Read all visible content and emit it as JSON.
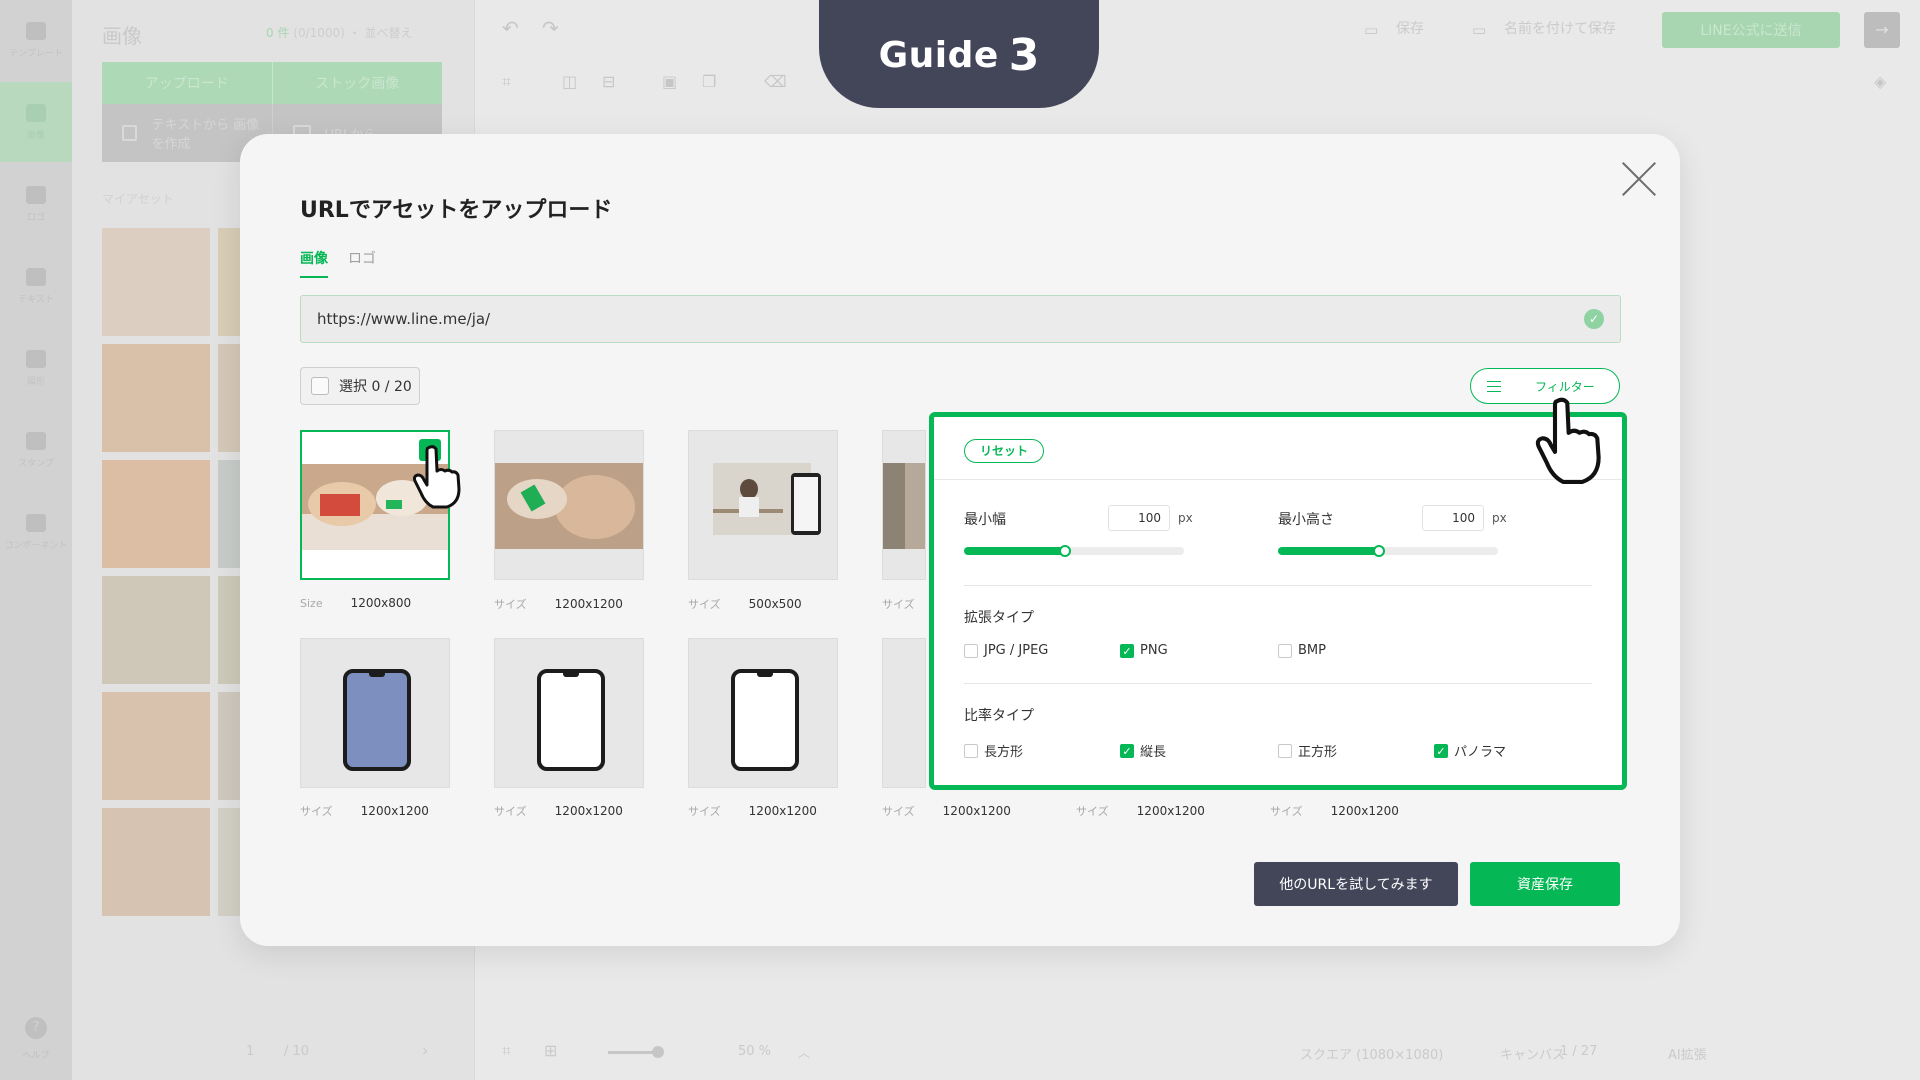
{
  "guide": {
    "label": "Guide",
    "number": "3"
  },
  "background": {
    "rail": [
      {
        "label": "テンプレート",
        "icon": "template-icon"
      },
      {
        "label": "画像",
        "icon": "image-icon"
      },
      {
        "label": "ロゴ",
        "icon": "logo-icon"
      },
      {
        "label": "テキスト",
        "icon": "text-icon"
      },
      {
        "label": "図形",
        "icon": "shape-icon"
      },
      {
        "label": "スタンプ",
        "icon": "stamp-icon"
      },
      {
        "label": "コンポーネント",
        "icon": "component-icon"
      }
    ],
    "rail_help": "ヘルプ",
    "panel_title": "画像",
    "panel_count_num": "0 件",
    "panel_count_rest": "(0/1000) ・ 並べ替え",
    "upload_tabs": [
      "アップロード",
      "ストック画像"
    ],
    "upload_buttons": [
      "テキストから 画像を作成",
      "URLから"
    ],
    "my_assets": "マイアセット",
    "save": "保存",
    "save_as": "名前を付けて保存",
    "send": "LINE公式に送信",
    "bottom": {
      "page_current": "1",
      "page_total": "/ 10",
      "zoom": "50 %",
      "canvas_size": "スクエア (1080×1080)",
      "canvas_label": "キャンバス",
      "canvas_pages": "1 / 27",
      "ai": "AI拡張"
    }
  },
  "modal": {
    "title": "URLでアセットをアップロード",
    "tabs": [
      "画像",
      "ロゴ"
    ],
    "url_value": "https://www.line.me/ja/",
    "select_label": "選択 0 / 20",
    "filter_label": "フィルター",
    "items": [
      {
        "size_key": "Size",
        "size": "1200x800",
        "selected": true
      },
      {
        "size_key": "サイズ",
        "size": "1200x1200",
        "selected": false
      },
      {
        "size_key": "サイズ",
        "size": "500x500",
        "selected": false
      },
      {
        "size_key": "サイズ",
        "size": "",
        "selected": false
      },
      {
        "size_key": "サイズ",
        "size": "1200x1200",
        "selected": false
      },
      {
        "size_key": "サイズ",
        "size": "1200x1200",
        "selected": false
      },
      {
        "size_key": "サイズ",
        "size": "1200x1200",
        "selected": false
      },
      {
        "size_key": "サイズ",
        "size": "1200x1200",
        "selected": false
      },
      {
        "size_key": "サイズ",
        "size": "1200x1200",
        "selected": false
      },
      {
        "size_key": "サイズ",
        "size": "1200x1200",
        "selected": false
      }
    ],
    "buttons": {
      "other_url": "他のURLを試してみます",
      "save_assets": "資産保存"
    },
    "filter": {
      "reset": "リセット",
      "min_width_label": "最小幅",
      "min_width_value": "100",
      "min_height_label": "最小高さ",
      "min_height_value": "100",
      "unit": "px",
      "min_width_slider_fraction": 0.46,
      "min_height_slider_fraction": 0.46,
      "ext_label": "拡張タイプ",
      "ext_options": [
        {
          "label": "JPG / JPEG",
          "checked": false
        },
        {
          "label": "PNG",
          "checked": true
        },
        {
          "label": "BMP",
          "checked": false
        }
      ],
      "ratio_label": "比率タイプ",
      "ratio_options": [
        {
          "label": "長方形",
          "checked": false
        },
        {
          "label": "縦長",
          "checked": true
        },
        {
          "label": "正方形",
          "checked": false
        },
        {
          "label": "パノラマ",
          "checked": true
        }
      ]
    }
  },
  "colors": {
    "accent": "#06b755",
    "dark": "#434659"
  }
}
